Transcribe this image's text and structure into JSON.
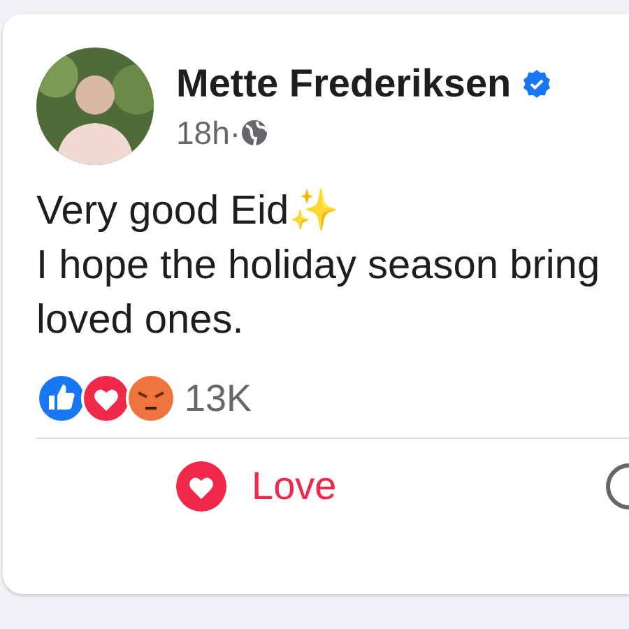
{
  "post": {
    "author": "Mette Frederiksen",
    "verified": true,
    "time": "18h·",
    "public_audience": true,
    "lines": [
      "Very good Eid✨",
      "I hope the holiday season bring",
      "loved ones."
    ],
    "reactions": [
      {
        "kind": "like"
      },
      {
        "kind": "love"
      },
      {
        "kind": "angry"
      }
    ],
    "reaction_count": "13K"
  },
  "actions": [
    {
      "kind": "love",
      "label": "Love",
      "selected": true
    },
    {
      "kind": "comment"
    }
  ]
}
